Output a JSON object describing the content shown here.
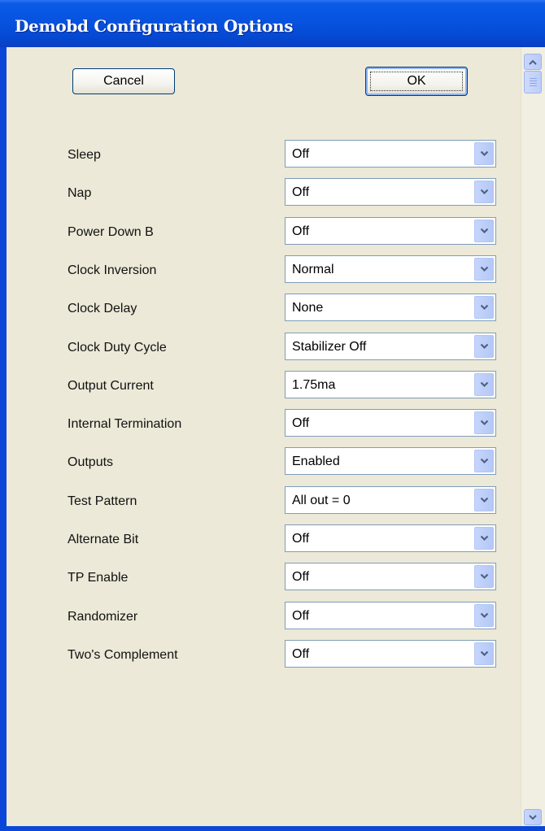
{
  "window": {
    "title": "Demobd Configuration Options"
  },
  "buttons": {
    "cancel": "Cancel",
    "ok": "OK"
  },
  "options": [
    {
      "label": "Sleep",
      "value": "Off"
    },
    {
      "label": "Nap",
      "value": "Off"
    },
    {
      "label": "Power Down B",
      "value": "Off"
    },
    {
      "label": "Clock Inversion",
      "value": "Normal"
    },
    {
      "label": "Clock Delay",
      "value": "None"
    },
    {
      "label": "Clock Duty Cycle",
      "value": "Stabilizer Off"
    },
    {
      "label": "Output Current",
      "value": "1.75ma"
    },
    {
      "label": "Internal Termination",
      "value": "Off"
    },
    {
      "label": "Outputs",
      "value": "Enabled"
    },
    {
      "label": "Test Pattern",
      "value": "All out = 0"
    },
    {
      "label": "Alternate Bit",
      "value": "Off"
    },
    {
      "label": "TP Enable",
      "value": "Off"
    },
    {
      "label": "Randomizer",
      "value": "Off"
    },
    {
      "label": "Two's Complement",
      "value": "Off"
    }
  ],
  "icons": {
    "dropdown": "chevron-down-icon",
    "scroll_up": "chevron-up-icon",
    "scroll_down": "chevron-down-icon"
  },
  "colors": {
    "titlebar": "#0753e0",
    "dialog_background": "#ece9d8",
    "dropdown_button": "#b4c8f6",
    "arrow": "#4d6185"
  }
}
